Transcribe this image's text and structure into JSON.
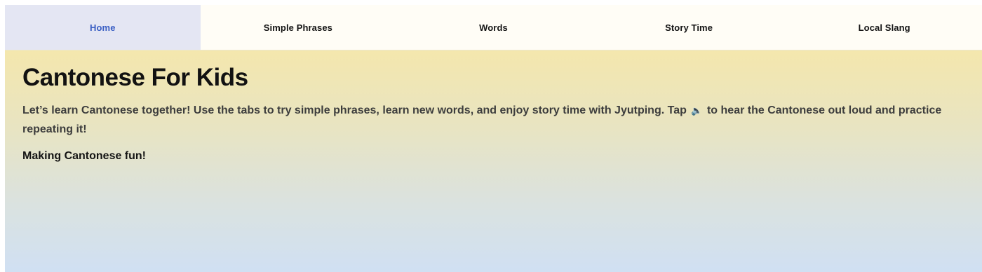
{
  "tabs": [
    {
      "label": "Home",
      "active": true
    },
    {
      "label": "Simple Phrases",
      "active": false
    },
    {
      "label": "Words",
      "active": false
    },
    {
      "label": "Story Time",
      "active": false
    },
    {
      "label": "Local Slang",
      "active": false
    }
  ],
  "main": {
    "title": "Cantonese For Kids",
    "intro_before_icon": "Let’s learn Cantonese together! Use the tabs to try simple phrases, learn new words, and enjoy story time with Jyutping. Tap",
    "intro_icon": "speaker-icon",
    "intro_after_icon": "to hear the Cantonese out loud and practice repeating it!",
    "tagline": "Making Cantonese fun!"
  },
  "colors": {
    "active_tab_bg": "#e4e6f3",
    "active_tab_text": "#3a5fc4",
    "gradient_top": "#f4e7ad",
    "gradient_bottom": "#d0e0f3"
  }
}
